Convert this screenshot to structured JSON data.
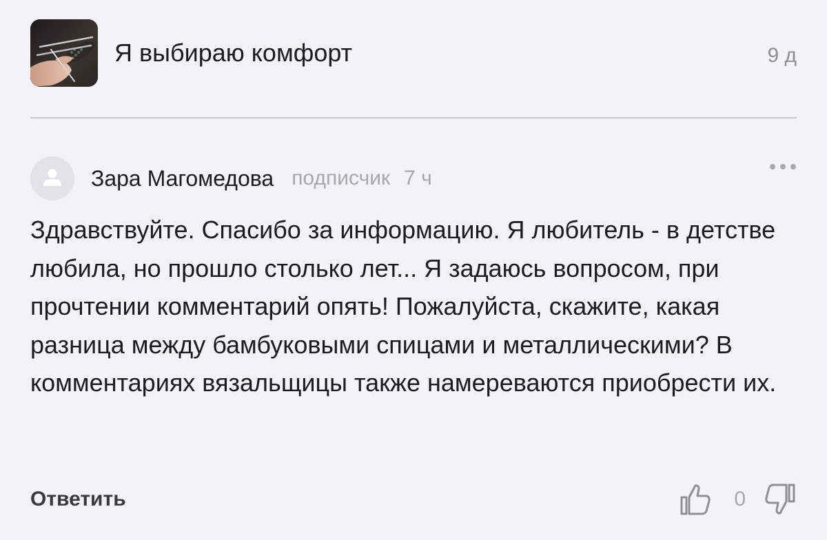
{
  "post": {
    "title": "Я выбираю комфорт",
    "age": "9 д"
  },
  "comment": {
    "author": "Зара Магомедова",
    "role": "подписчик",
    "time": "7 ч",
    "text": "Здравствуйте. Спасибо за информацию. Я любитель - в детстве любила, но прошло столько лет... Я задаюсь вопросом, при прочтении комментарий опять! Пожалуйста, скажите, какая разница между бамбуковыми спицами и металлическими? В комментариях вязальщицы также намереваются приобрести их.",
    "reply_label": "Ответить",
    "like_count": "0"
  },
  "icons": {
    "thumbnail": "knitting-needles-photo",
    "avatar": "user-placeholder-icon",
    "more": "more-dots-icon",
    "like": "thumbs-up-icon",
    "dislike": "thumbs-down-icon"
  },
  "colors": {
    "background": "#f2f2f7",
    "muted_text": "#a7a7ad",
    "divider": "#c7c7cc",
    "avatar_bg": "#e1e3e8"
  }
}
